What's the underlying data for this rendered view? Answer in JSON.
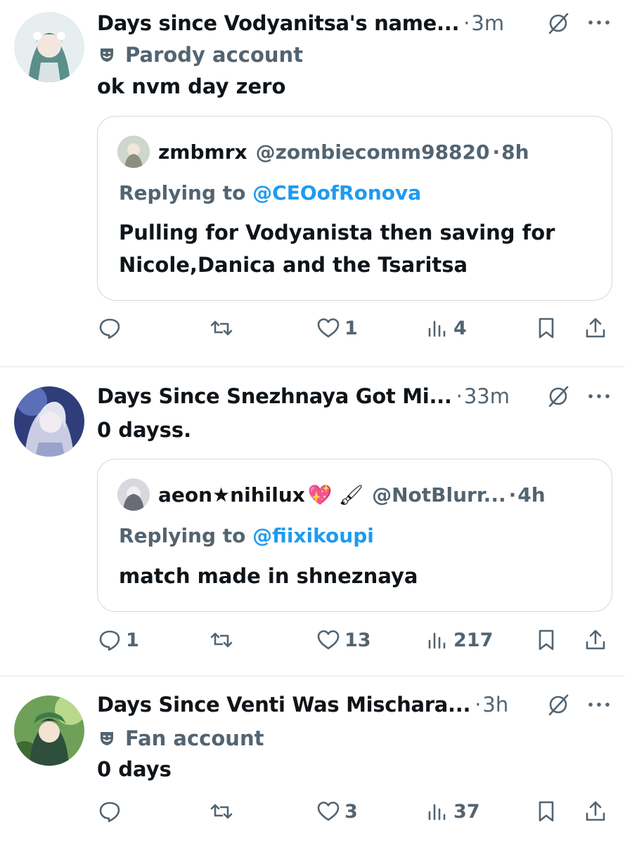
{
  "posts": [
    {
      "display_name": "Days since Vodyanitsa's name...",
      "time": "3m",
      "account_label": "Parody account",
      "account_icon": "mask-icon",
      "text": "ok nvm day zero",
      "quote": {
        "display_name": "zmbmrx",
        "handle": "@zombiecomm98820",
        "time": "8h",
        "replying_prefix": "Replying to",
        "replying_to": "@CEOofRonova",
        "text": "Pulling for Vodyanista then saving for Nicole,Danica and the Tsaritsa"
      },
      "metrics": {
        "replies": "",
        "reposts": "",
        "likes": "1",
        "views": "4"
      }
    },
    {
      "display_name": "Days Since Snezhnaya Got Mi...",
      "time": "33m",
      "text": "0 dayss.",
      "quote": {
        "display_name": "aeon★nihilux",
        "emoji": "💖 🖌",
        "handle": "@NotBlurr...",
        "time": "4h",
        "replying_prefix": "Replying to",
        "replying_to": "@fiixikoupi",
        "text": "match made in shneznaya"
      },
      "metrics": {
        "replies": "1",
        "reposts": "",
        "likes": "13",
        "views": "217"
      }
    },
    {
      "display_name": "Days Since Venti Was Mischara...",
      "time": "3h",
      "account_label": "Fan account",
      "account_icon": "mask-icon",
      "text": "0 days",
      "metrics": {
        "replies": "",
        "reposts": "",
        "likes": "3",
        "views": "37"
      }
    }
  ],
  "separator": "·",
  "colors": {
    "text": "#0f1419",
    "secondary": "#536471",
    "link": "#1d9bf0",
    "border": "#cfd9de"
  }
}
